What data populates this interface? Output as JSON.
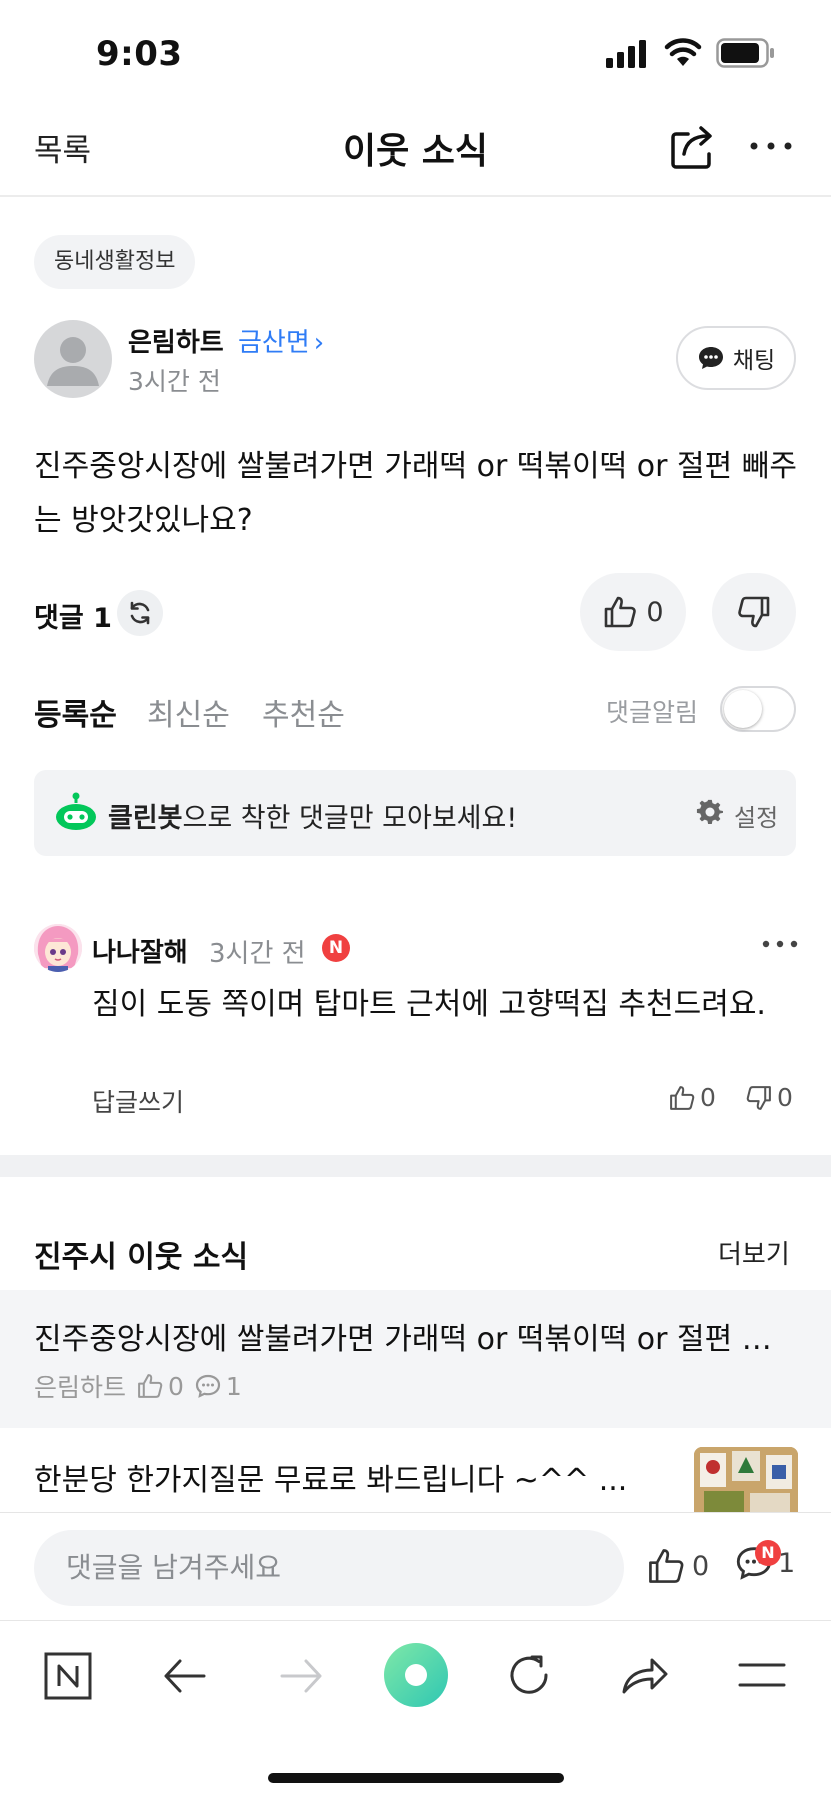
{
  "status_bar": {
    "time": "9:03"
  },
  "nav": {
    "back_label": "목록",
    "title": "이웃 소식"
  },
  "post": {
    "category": "동네생활정보",
    "author": "은림하트",
    "location": "금산면",
    "time": "3시간 전",
    "chat_label": "채팅",
    "body": "진주중앙시장에 쌀불려가면 가래떡 or 떡볶이떡 or 절편 빼주는 방앗갓있나요?",
    "comment_label": "댓글",
    "comment_count": "1",
    "like_count": "0"
  },
  "sort": {
    "options": [
      "등록순",
      "최신순",
      "추천순"
    ],
    "alarm_label": "댓글알림",
    "alarm_on": false
  },
  "cleanbot": {
    "name": "클린봇",
    "text": "으로 착한 댓글만 모아보세요!",
    "settings_label": "설정"
  },
  "comments": [
    {
      "author": "나나잘해",
      "time": "3시간 전",
      "badge": "N",
      "text": "짐이 도동 쪽이며 탑마트 근처에 고향떡집 추천드려요.",
      "reply_label": "답글쓰기",
      "likes": "0",
      "dislikes": "0"
    }
  ],
  "related": {
    "title": "진주시 이웃 소식",
    "more_label": "더보기",
    "items": [
      {
        "title": "진주중앙시장에 쌀불려가면 가래떡 or 떡볶이떡 or 절편 빼주는 방앗갓있나요?",
        "author": "은림하트",
        "likes": "0",
        "comments": "1"
      },
      {
        "title": "한분당 한가지질문 무료로 봐드립니다 ~^^ ..."
      }
    ]
  },
  "comment_bar": {
    "placeholder": "댓글을 남겨주세요",
    "likes": "0",
    "comments": "1",
    "badge": "N"
  },
  "colors": {
    "accent_blue": "#2f7cf6",
    "badge_red": "#f04040",
    "green": "#03c75a"
  }
}
